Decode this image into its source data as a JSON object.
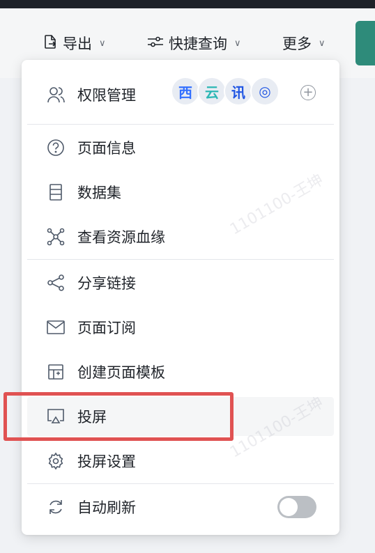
{
  "toolbar": {
    "export_label": "导出",
    "quick_query_label": "快捷查询",
    "more_label": "更多"
  },
  "menu": {
    "permissions": {
      "label": "权限管理",
      "avatars": [
        {
          "text": "西",
          "color": "#3370ff"
        },
        {
          "text": "云",
          "color": "#2db7b5"
        },
        {
          "text": "讯",
          "color": "#1f55e3"
        },
        {
          "text": "◎",
          "color": "#1f55e3"
        }
      ]
    },
    "page_info": "页面信息",
    "dataset": "数据集",
    "view_lineage": "查看资源血缘",
    "share_link": "分享链接",
    "page_subscribe": "页面订阅",
    "create_template": "创建页面模板",
    "screencast": "投屏",
    "screencast_settings": "投屏设置",
    "auto_refresh": {
      "label": "自动刷新",
      "enabled": false
    }
  },
  "watermark": "1101100-王坤",
  "colors": {
    "highlight": "#e05252",
    "accent": "#2e8b7a"
  }
}
